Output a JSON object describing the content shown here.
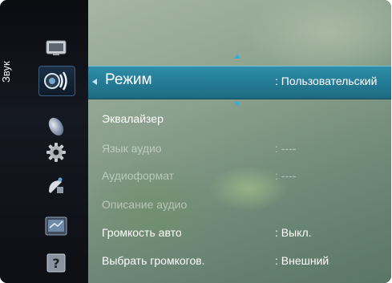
{
  "sidebar": {
    "section_label": "Звук",
    "icons": [
      "picture-icon",
      "sound-icon",
      "channel-icon",
      "settings-icon",
      "input-icon",
      "application-icon",
      "support-icon"
    ]
  },
  "menu": {
    "selected": {
      "label": "Режим",
      "value": ": Пользовательский"
    },
    "items": [
      {
        "label": "Эквалайзер",
        "value": "",
        "enabled": true
      },
      {
        "label": "Язык аудио",
        "value": ": ----",
        "enabled": false
      },
      {
        "label": "Аудиоформат",
        "value": ": ----",
        "enabled": false
      },
      {
        "label": "Описание аудио",
        "value": "",
        "enabled": false
      },
      {
        "label": "Громкость авто",
        "value": ": Выкл.",
        "enabled": true
      },
      {
        "label": "Выбрать громкогов.",
        "value": ": Внешний",
        "enabled": true
      }
    ]
  },
  "colors": {
    "accent": "#2a86a0",
    "arrow": "#3ab0d0"
  }
}
